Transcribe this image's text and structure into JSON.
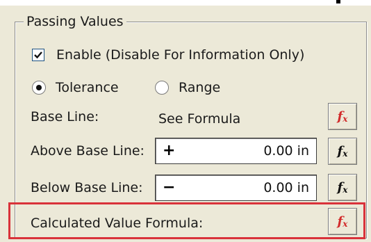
{
  "group": {
    "title": "Passing Values"
  },
  "enable": {
    "label": "Enable (Disable For Information Only)",
    "checked": true
  },
  "mode": {
    "tolerance_label": "Tolerance",
    "range_label": "Range",
    "selected": "Tolerance"
  },
  "base_line": {
    "label": "Base Line:",
    "value": "See Formula"
  },
  "above_base_line": {
    "label": "Above Base Line:",
    "sign": "+",
    "value": "0.00 in"
  },
  "below_base_line": {
    "label": "Below Base Line:",
    "sign": "−",
    "value": "0.00 in"
  },
  "calculated_value": {
    "label": "Calculated Value Formula:"
  },
  "fx": {
    "label": "fx",
    "active_color": "#d22b2b",
    "default_color": "#111111"
  },
  "highlight_color": "#d9323a"
}
